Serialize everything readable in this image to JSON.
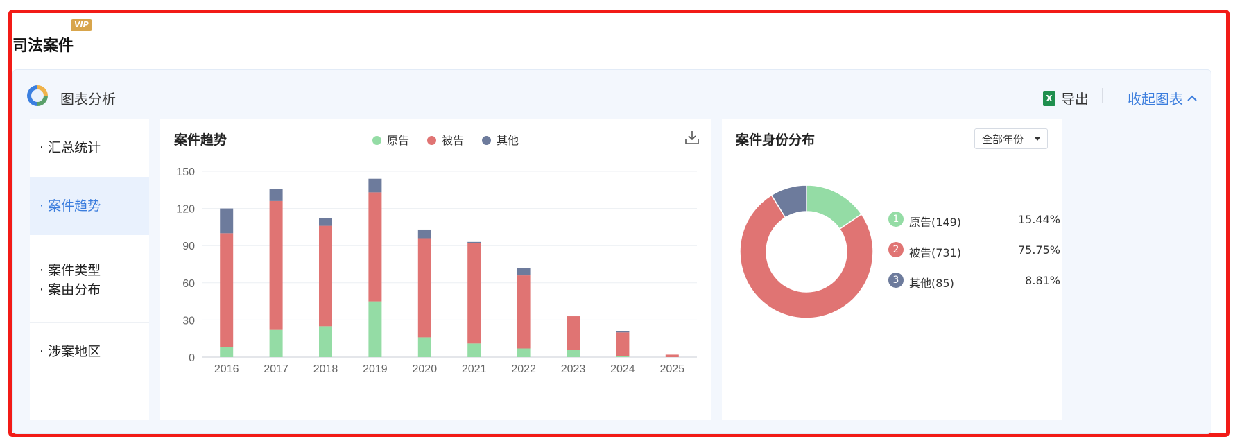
{
  "badge": "VIP",
  "page_title": "司法案件",
  "panel": {
    "title": "图表分析",
    "export_label": "导出",
    "collapse_label": "收起图表"
  },
  "nav": {
    "items": [
      "· 汇总统计",
      "· 案件趋势",
      "· 案件类型",
      "· 案由分布",
      "· 涉案地区"
    ]
  },
  "trend": {
    "title": "案件趋势"
  },
  "identity": {
    "title": "案件身份分布",
    "year_select": "全部年份"
  },
  "colors": {
    "plaintiff": "#94dca5",
    "defendant": "#e07473",
    "other": "#6d7b9c",
    "accent": "#3b7ddd"
  },
  "chart_data": [
    {
      "type": "bar",
      "title": "案件趋势",
      "stacked": true,
      "categories": [
        "2016",
        "2017",
        "2018",
        "2019",
        "2020",
        "2021",
        "2022",
        "2023",
        "2024",
        "2025"
      ],
      "series": [
        {
          "name": "原告",
          "values": [
            8,
            22,
            25,
            45,
            16,
            11,
            7,
            6,
            1,
            0
          ]
        },
        {
          "name": "被告",
          "values": [
            92,
            104,
            81,
            88,
            80,
            81,
            59,
            27,
            19,
            2
          ]
        },
        {
          "name": "其他",
          "values": [
            20,
            10,
            6,
            11,
            7,
            1,
            6,
            0,
            1,
            0
          ]
        }
      ],
      "ylim": [
        0,
        150
      ],
      "yticks": [
        0,
        30,
        60,
        90,
        120,
        150
      ],
      "grid": true,
      "legend": "top"
    },
    {
      "type": "pie",
      "title": "案件身份分布",
      "donut": true,
      "slices": [
        {
          "label": "原告",
          "count": 149,
          "percent": "15.44%"
        },
        {
          "label": "被告",
          "count": 731,
          "percent": "75.75%"
        },
        {
          "label": "其他",
          "count": 85,
          "percent": "8.81%"
        }
      ],
      "row_labels": [
        "原告(149)",
        "被告(731)",
        "其他(85)"
      ],
      "legend": "right"
    }
  ]
}
